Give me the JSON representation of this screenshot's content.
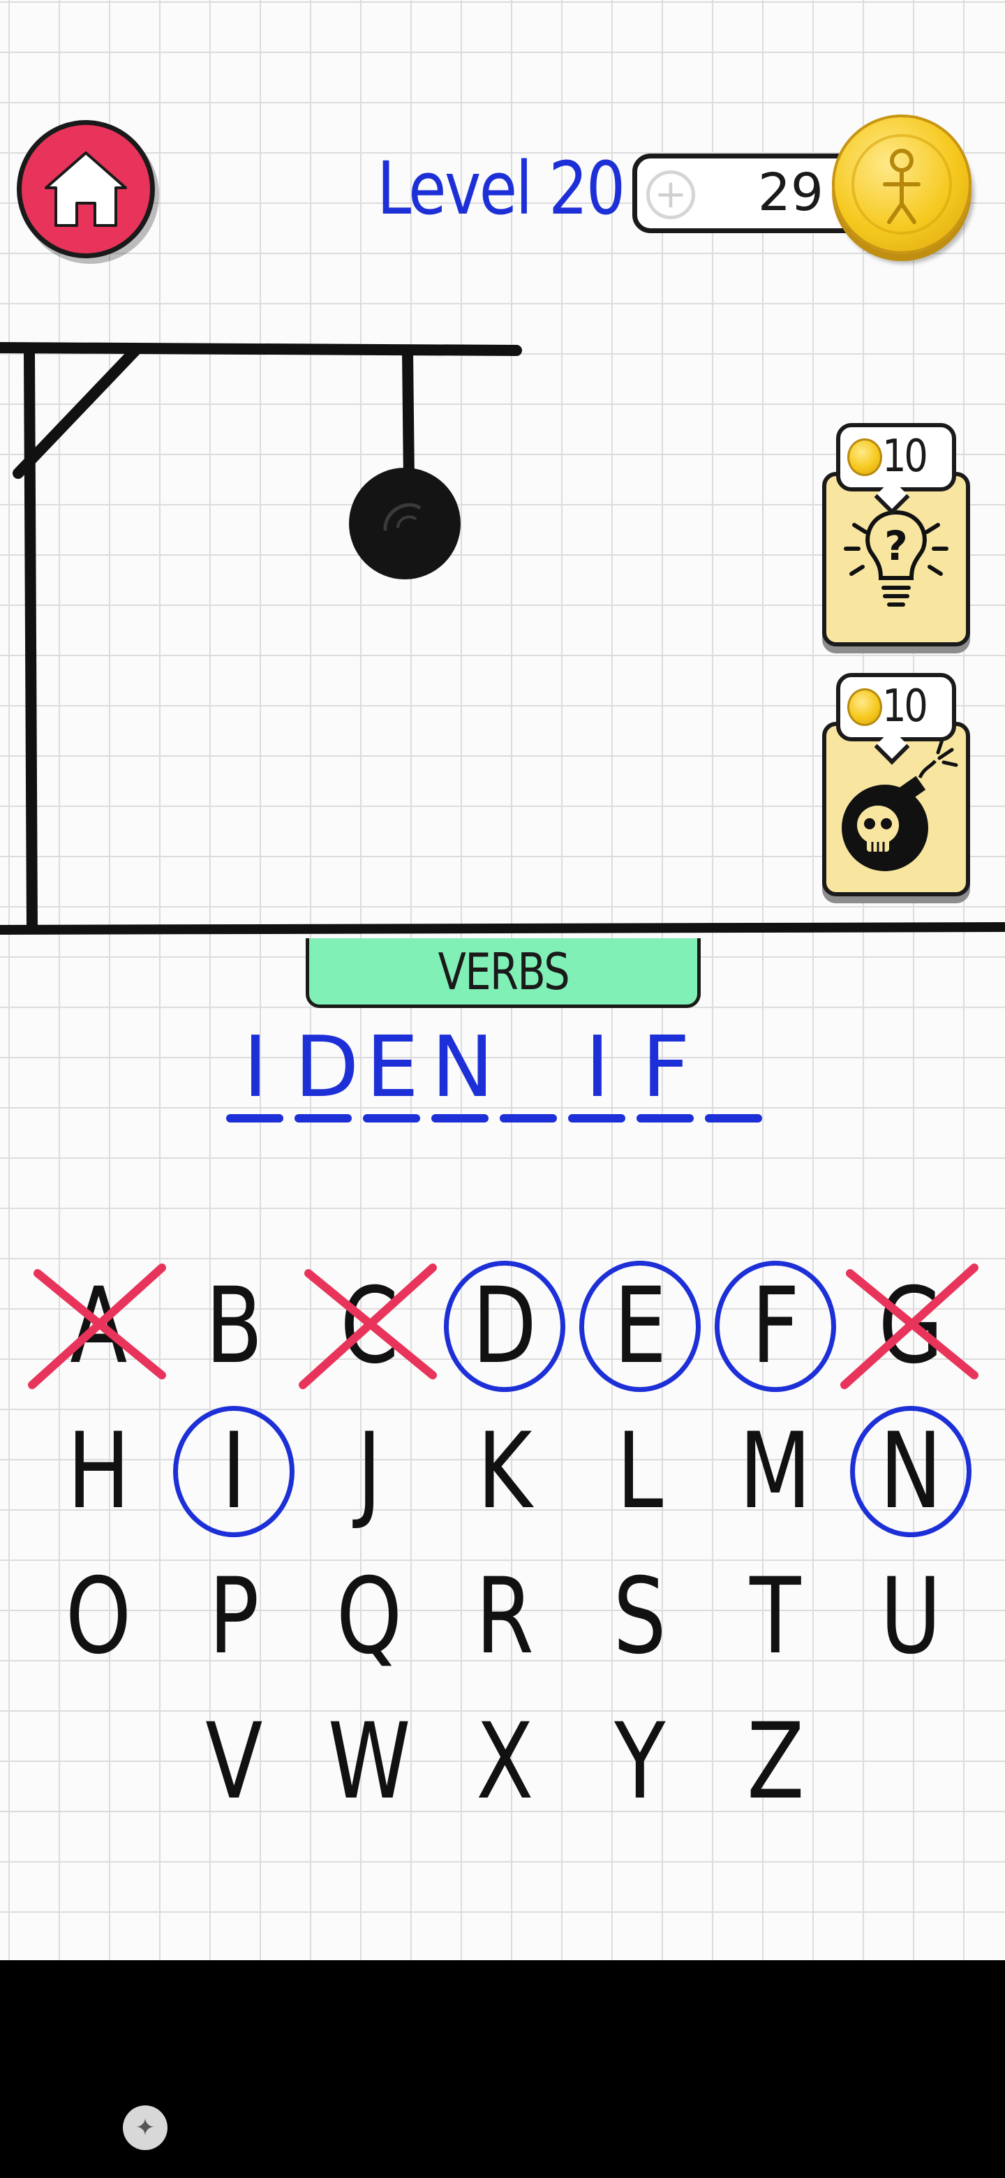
{
  "header": {
    "home_icon": "home-icon",
    "level_label": "Level 20",
    "coins": "29",
    "add_coins_icon": "plus-icon",
    "coin_icon": "stickman-coin-icon"
  },
  "powerups": [
    {
      "name": "hint",
      "price": "10",
      "icon": "lightbulb-question-icon"
    },
    {
      "name": "bomb",
      "price": "10",
      "icon": "skull-bomb-icon"
    }
  ],
  "hangman": {
    "wrong_guesses": 3,
    "parts_shown": [
      "head"
    ]
  },
  "puzzle": {
    "category": "VERBS",
    "slots": [
      "I",
      "D",
      "E",
      "N",
      "",
      "I",
      "F",
      ""
    ]
  },
  "keyboard": {
    "rows": [
      [
        "A",
        "B",
        "C",
        "D",
        "E",
        "F",
        "G"
      ],
      [
        "H",
        "I",
        "J",
        "K",
        "L",
        "M",
        "N"
      ],
      [
        "O",
        "P",
        "Q",
        "R",
        "S",
        "T",
        "U"
      ],
      [
        "V",
        "W",
        "X",
        "Y",
        "Z"
      ]
    ],
    "correct": [
      "D",
      "E",
      "F",
      "I",
      "N"
    ],
    "wrong": [
      "A",
      "C",
      "G"
    ],
    "colors": {
      "correct": "#1d2fd6",
      "wrong": "#e8345a"
    }
  },
  "system": {
    "nav_icon": "assistant-icon"
  }
}
